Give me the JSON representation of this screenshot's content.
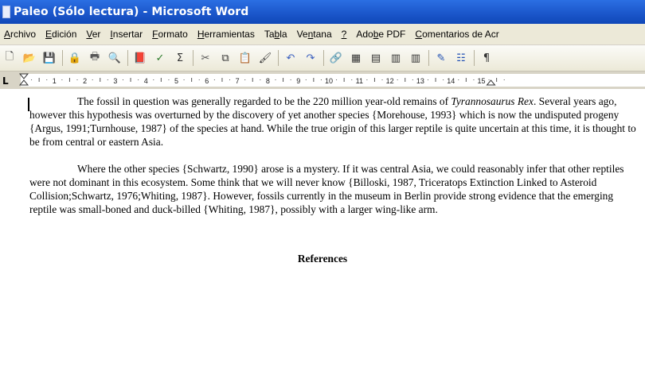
{
  "window": {
    "title": "Paleo (Sólo lectura) - Microsoft Word"
  },
  "menu": [
    {
      "label": "Archivo",
      "underline": "A"
    },
    {
      "label": "Edición",
      "underline": "E"
    },
    {
      "label": "Ver",
      "underline": "V"
    },
    {
      "label": "Insertar",
      "underline": "I"
    },
    {
      "label": "Formato",
      "underline": "F"
    },
    {
      "label": "Herramientas",
      "underline": "H"
    },
    {
      "label": "Tabla",
      "underline": "b"
    },
    {
      "label": "Ventana",
      "underline": "n"
    },
    {
      "label": "?",
      "underline": "?"
    },
    {
      "label": "Adobe PDF",
      "underline": "b"
    },
    {
      "label": "Comentarios de Acr",
      "underline": "C"
    }
  ],
  "toolbar": {
    "icons": [
      "new-document-icon",
      "open-folder-icon",
      "save-icon",
      "permission-icon",
      "print-icon",
      "print-preview-icon",
      "research-icon",
      "spelling-icon",
      "word-count-icon",
      "cut-icon",
      "copy-icon",
      "paste-icon",
      "format-painter-icon",
      "undo-icon",
      "redo-icon",
      "hyperlink-icon",
      "tables-borders-icon",
      "insert-table-icon",
      "insert-excel-icon",
      "columns-icon",
      "drawing-icon",
      "document-map-icon",
      "show-formatting-icon"
    ]
  },
  "ruler": {
    "numbers": [
      "1",
      "2",
      "3",
      "4",
      "5",
      "6",
      "7",
      "8",
      "9",
      "10",
      "11",
      "12",
      "13",
      "14",
      "15"
    ]
  },
  "document": {
    "para1": {
      "first": "The fossil in question was generally regarded to be the 220 million year-old remains of",
      "italic": "Tyrannosaurus Rex",
      "rest": ".  Several years ago, however this hypothesis was overturned by the discovery of yet another species {Morehouse, 1993} which is now the undisputed progeny {Argus, 1991;Turnhouse, 1987} of the species at hand.  While the true origin of this larger reptile is quite uncertain at this time, it is thought to be from central or eastern Asia."
    },
    "para2": "Where the other species {Schwartz, 1990} arose is a mystery.  If it was central Asia, we could reasonably infer that other reptiles were not dominant in this ecosystem.  Some think that we will never know {Billoski, 1987, Triceratops Extinction Linked to Asteroid Collision;Schwartz, 1976;Whiting, 1987}.  However, fossils currently in the museum in Berlin provide strong evidence that the emerging reptile was small-boned and duck-billed {Whiting, 1987}, possibly with a larger wing-like arm.",
    "references_heading": "References"
  }
}
